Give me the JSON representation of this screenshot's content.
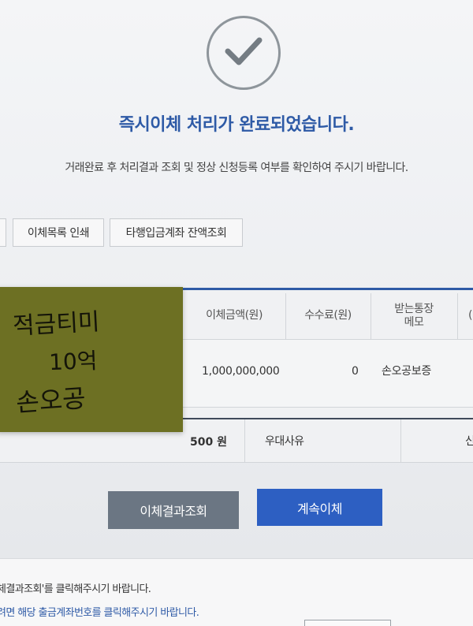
{
  "result": {
    "title": "즉시이체 처리가 완료되었습니다.",
    "subtitle": "거래완료 후 처리결과 조회 및 정상 신청등록 여부를 확인하여 주시기 바랍니다.",
    "status_icon": "check-icon"
  },
  "toolbar": {
    "print_label": "이체목록 인쇄",
    "balance_label": "타행입금계좌 잔액조회"
  },
  "table": {
    "headers": {
      "amount": "이체금액(원)",
      "fee": "수수료(원)",
      "memo_line1": "받는통장",
      "memo_line2": "메모",
      "more": "("
    },
    "row": {
      "amount": "1,000,000,000",
      "fee": "0",
      "memo": "손오공보증"
    },
    "summary": {
      "amount": "500 원",
      "reason": "우대사유",
      "more": "신"
    }
  },
  "sticky_note": {
    "line1": "적금티미",
    "line2": "10억",
    "line3": "손오공"
  },
  "actions": {
    "result_label": "이체결과조회",
    "continue_label": "계속이체"
  },
  "footer": {
    "note1": "체결과조회'를 클릭해주시기 바랍니다.",
    "note2": "려면 해당 출금계좌번호를 클릭해주시기 바랍니다."
  },
  "colors": {
    "accent": "#2e5aa6",
    "primary_button": "#2d5fc2",
    "secondary_button": "#6b7683",
    "sticky_note": "#6d7023"
  }
}
